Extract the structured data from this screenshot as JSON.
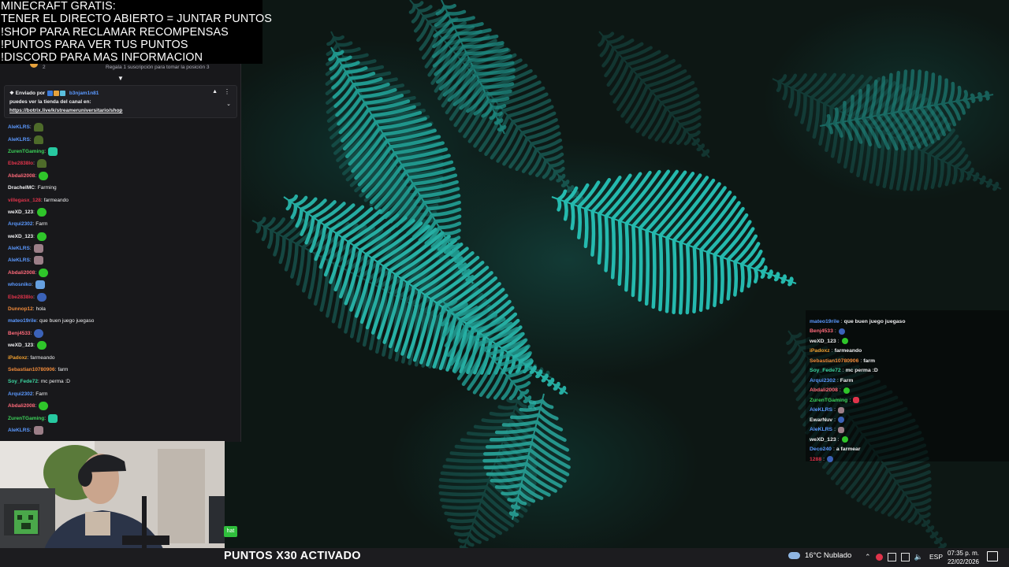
{
  "overlay": {
    "lines": [
      "MINECRAFT GRATIS:",
      "TENER EL DIRECTO ABIERTO = JUNTAR PUNTOS",
      "!SHOP PARA RECLAMAR RECOMPENSAS",
      "!PUNTOS PARA VER TUS PUNTOS",
      "!DISCORD PARA MAS INFORMACION"
    ]
  },
  "chat": {
    "gift_count": "2",
    "gift_text": "Regala 1 suscripción para tomar la posición 3",
    "pinned": {
      "sent_by": "Enviado por",
      "user": "b3njam1n81",
      "message": "puedes ver la tienda del canal en:",
      "link": "https://botrix.live/k/streameruniversitario/shop"
    },
    "messages": [
      {
        "user": "AleKLRS",
        "color": "#5b99ff",
        "text": "",
        "emote": "em-pepe"
      },
      {
        "user": "AleKLRS",
        "color": "#5b99ff",
        "text": "",
        "emote": "em-pepe"
      },
      {
        "user": "ZurenTGaming",
        "color": "#3cd45a",
        "text": "",
        "emote": "em-teal"
      },
      {
        "user": "Ebe2838lo",
        "color": "#e0344b",
        "text": "",
        "emote": "em-pepe"
      },
      {
        "user": "Abdali2008",
        "color": "#ff6a7a",
        "text": "",
        "emote": "em-green"
      },
      {
        "user": "DrachelMC",
        "color": "#efeff1",
        "text": "Farming",
        "emote": ""
      },
      {
        "user": "villegasx_128",
        "color": "#e0344b",
        "text": "farmeando",
        "emote": ""
      },
      {
        "user": "weXD_123",
        "color": "#efeff1",
        "text": "",
        "emote": "em-green"
      },
      {
        "user": "Arqui2302",
        "color": "#5b99ff",
        "text": "Farm",
        "emote": ""
      },
      {
        "user": "weXD_123",
        "color": "#efeff1",
        "text": "",
        "emote": "em-green"
      },
      {
        "user": "AleKLRS",
        "color": "#5b99ff",
        "text": "",
        "emote": "em-cat"
      },
      {
        "user": "AleKLRS",
        "color": "#5b99ff",
        "text": "",
        "emote": "em-cat"
      },
      {
        "user": "Abdali2008",
        "color": "#ff6a7a",
        "text": "",
        "emote": "em-green"
      },
      {
        "user": "whosniko",
        "color": "#5b99ff",
        "text": "",
        "emote": "em-spot"
      },
      {
        "user": "Ebe2838lo",
        "color": "#e0344b",
        "text": "",
        "emote": "em-blue"
      },
      {
        "user": "Dunnop12",
        "color": "#f08a3a",
        "text": "hola",
        "emote": ""
      },
      {
        "user": "mateo19rile",
        "color": "#5b99ff",
        "text": "que buen juego juegaso",
        "emote": ""
      },
      {
        "user": "Benj4533",
        "color": "#ff6a7a",
        "text": "",
        "emote": "em-blue"
      },
      {
        "user": "weXD_123",
        "color": "#efeff1",
        "text": "",
        "emote": "em-green"
      },
      {
        "user": "iPadoxz",
        "color": "#f0a030",
        "text": "farmeando",
        "emote": ""
      },
      {
        "user": "Sebastian10780906",
        "color": "#f08a3a",
        "text": "farm",
        "emote": ""
      },
      {
        "user": "Soy_Fede72",
        "color": "#3cd4a0",
        "text": "mc perma :D",
        "emote": ""
      },
      {
        "user": "Arqui2302",
        "color": "#5b99ff",
        "text": "Farm",
        "emote": ""
      },
      {
        "user": "Abdali2008",
        "color": "#ff6a7a",
        "text": "",
        "emote": "em-green"
      },
      {
        "user": "ZurenTGaming",
        "color": "#3cd45a",
        "text": "",
        "emote": "em-teal"
      },
      {
        "user": "AleKLRS",
        "color": "#5b99ff",
        "text": "",
        "emote": "em-cat"
      }
    ],
    "chat_button": "hat"
  },
  "right_chat": {
    "messages": [
      {
        "user": "mateo19rile",
        "color": "#5b99ff",
        "text": "que buen juego juegaso",
        "emote": ""
      },
      {
        "user": "Benj4533",
        "color": "#ff6a7a",
        "text": "",
        "emote": "em-blue"
      },
      {
        "user": "weXD_123",
        "color": "#efeff1",
        "text": "",
        "emote": "em-green"
      },
      {
        "user": "iPadoxz",
        "color": "#f0a030",
        "text": "farmeando",
        "emote": ""
      },
      {
        "user": "Sebastian10780906",
        "color": "#f08a3a",
        "text": "farm",
        "emote": ""
      },
      {
        "user": "Soy_Fede72",
        "color": "#3cd4a0",
        "text": "mc perma :D",
        "emote": ""
      },
      {
        "user": "Arqui2302",
        "color": "#5b99ff",
        "text": "Farm",
        "emote": ""
      },
      {
        "user": "Abdali2008",
        "color": "#ff6a7a",
        "text": "",
        "emote": "em-green"
      },
      {
        "user": "ZurenTGaming",
        "color": "#3cd45a",
        "text": "",
        "emote": "em-red"
      },
      {
        "user": "AleKLRS",
        "color": "#5b99ff",
        "text": "",
        "emote": "em-cat"
      },
      {
        "user": "EwarNuv",
        "color": "#efeff1",
        "text": "",
        "emote": "em-blue"
      },
      {
        "user": "AleKLRS",
        "color": "#5b99ff",
        "text": "",
        "emote": "em-cat"
      },
      {
        "user": "weXD_123",
        "color": "#efeff1",
        "text": "",
        "emote": "em-green"
      },
      {
        "user": "Deco240",
        "color": "#5b99ff",
        "text": "a farmear",
        "emote": ""
      },
      {
        "user": "1288",
        "color": "#e0344b",
        "text": "",
        "emote": "em-blue"
      }
    ]
  },
  "ticker": "PUNTOS X30 ACTIVADO",
  "taskbar": {
    "weather": "16°C  Nublado",
    "language": "ESP",
    "time": "07:35 p. m.",
    "date": "22/02/2026"
  }
}
